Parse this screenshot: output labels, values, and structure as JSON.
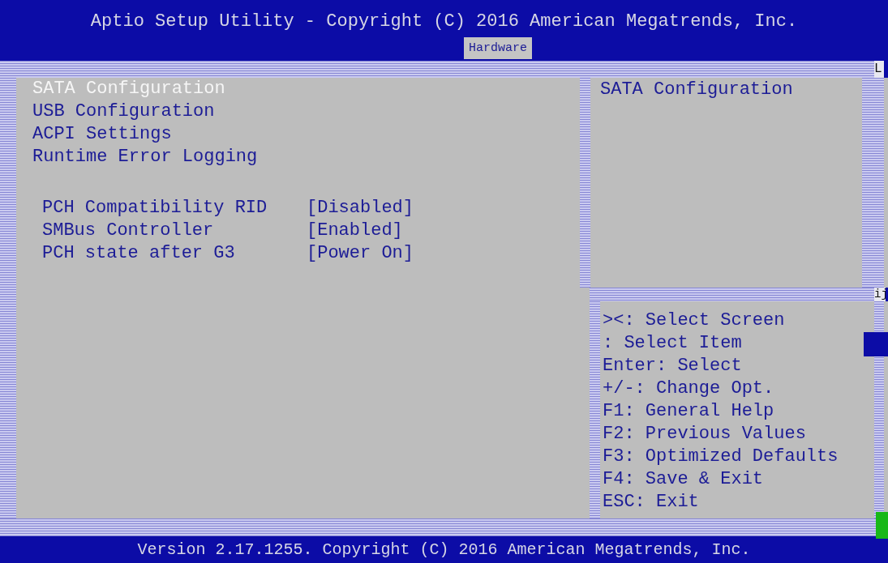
{
  "header": {
    "title": "Aptio Setup Utility - Copyright (C) 2016 American Megatrends, Inc."
  },
  "tabs": [
    {
      "label": "Hardware",
      "selected": true
    }
  ],
  "frame_glyphs": {
    "top_right": "L",
    "divider_right": "ij"
  },
  "menu": {
    "items": [
      {
        "label": "SATA Configuration",
        "selected": true
      },
      {
        "label": "USB Configuration",
        "selected": false
      },
      {
        "label": "ACPI Settings",
        "selected": false
      },
      {
        "label": "Runtime Error Logging",
        "selected": false
      }
    ]
  },
  "settings": [
    {
      "label": "PCH Compatibility RID",
      "value": "[Disabled]"
    },
    {
      "label": "SMBus Controller",
      "value": "[Enabled]"
    },
    {
      "label": "PCH state after G3",
      "value": "[Power On]"
    }
  ],
  "help": {
    "item_help": "SATA Configuration",
    "keys": [
      "><: Select Screen",
      ": Select Item",
      "Enter: Select",
      "+/-: Change Opt.",
      "F1: General Help",
      "F2: Previous Values",
      "F3: Optimized Defaults",
      "F4: Save & Exit",
      "ESC: Exit"
    ]
  },
  "footer": {
    "version": "Version 2.17.1255. Copyright (C) 2016 American Megatrends, Inc."
  }
}
